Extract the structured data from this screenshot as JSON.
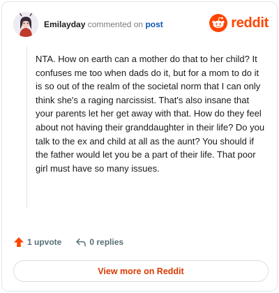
{
  "header": {
    "username": "Emilayday",
    "action_text": "commented on",
    "post_link": "post",
    "brand_text": "reddit"
  },
  "comment": {
    "body": "NTA. How on earth can a mother do that to her child? It confuses me too when dads do it, but for a mom to do it is so out of the realm of the societal norm that I can only think she's a raging narcissist. That's also insane that your parents let her get away with that. How do they feel about not having their granddaughter in their life? Do you talk to the ex and child at all as the aunt? You should if the father would let you be a part of their life. That poor girl must have so many issues."
  },
  "actions": {
    "upvotes": "1 upvote",
    "replies": "0 replies"
  },
  "footer": {
    "view_more": "View more on Reddit"
  },
  "colors": {
    "brand": "#ff4500",
    "link": "#0b53b7",
    "button_text": "#d93a00",
    "muted": "#576f76"
  },
  "icons": {
    "avatar": "avatar-icon",
    "logo": "reddit-logo-icon",
    "upvote": "upvote-arrow-icon",
    "reply": "reply-arrow-icon"
  }
}
